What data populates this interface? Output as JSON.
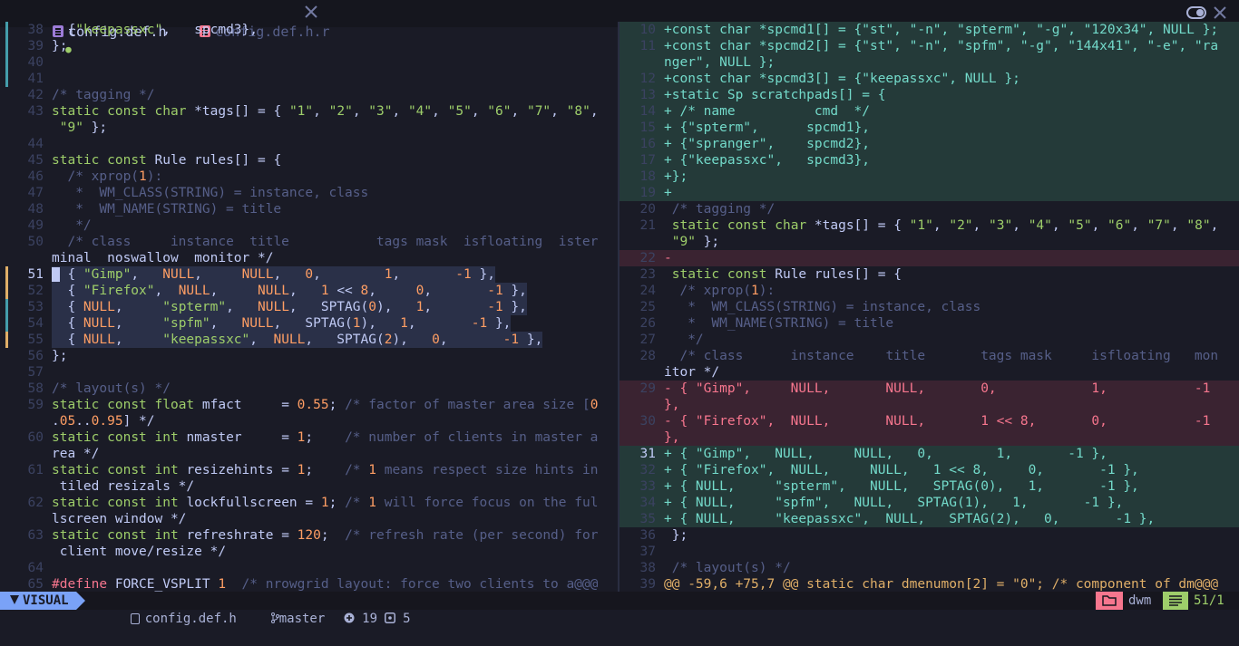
{
  "tabs": [
    {
      "label": "config.def.h",
      "active": true,
      "modified": true,
      "modified_glyph": "●"
    },
    {
      "label": "config.def.h.r",
      "active": false
    }
  ],
  "left": {
    "rows": [
      {
        "n": "38",
        "g": "grn",
        "t": "  {\"keepassxc\",   spcmd3},"
      },
      {
        "n": "39",
        "g": "grn",
        "t": "};"
      },
      {
        "n": "40",
        "g": "grn",
        "t": ""
      },
      {
        "n": "41",
        "g": "grn",
        "t": ""
      },
      {
        "n": "42",
        "t": "/* tagging */"
      },
      {
        "n": "43",
        "t": "static const char *tags[] = { \"1\", \"2\", \"3\", \"4\", \"5\", \"6\", \"7\", \"8\","
      },
      {
        "n": "",
        "t": " \"9\" };"
      },
      {
        "n": "44",
        "t": ""
      },
      {
        "n": "45",
        "t": "static const Rule rules[] = {"
      },
      {
        "n": "46",
        "t": "  /* xprop(1):"
      },
      {
        "n": "47",
        "t": "   *  WM_CLASS(STRING) = instance, class"
      },
      {
        "n": "48",
        "t": "   *  WM_NAME(STRING) = title"
      },
      {
        "n": "49",
        "t": "   */"
      },
      {
        "n": "50",
        "t": "  /* class     instance  title           tags mask  isfloating  ister"
      },
      {
        "n": "",
        "t": "minal  noswallow  monitor */"
      },
      {
        "n": "51",
        "g": "chg",
        "cur": true,
        "sel": true,
        "t": "  { \"Gimp\",   NULL,     NULL,   0,        1,       -1 },"
      },
      {
        "n": "52",
        "g": "chg",
        "sel": true,
        "t": "  { \"Firefox\",  NULL,     NULL,   1 << 8,     0,       -1 },"
      },
      {
        "n": "53",
        "g": "grn",
        "sel": true,
        "t": "  { NULL,     \"spterm\",   NULL,   SPTAG(0),   1,       -1 },"
      },
      {
        "n": "54",
        "g": "grn",
        "sel": true,
        "t": "  { NULL,     \"spfm\",   NULL,   SPTAG(1),   1,       -1 },"
      },
      {
        "n": "55",
        "g": "chg",
        "sel": true,
        "t": "  { NULL,     \"keepassxc\",  NULL,   SPTAG(2),   0,       -1 },"
      },
      {
        "n": "56",
        "t": "};"
      },
      {
        "n": "57",
        "t": ""
      },
      {
        "n": "58",
        "t": "/* layout(s) */"
      },
      {
        "n": "59",
        "t": "static const float mfact     = 0.55; /* factor of master area size [0"
      },
      {
        "n": "",
        "t": ".05..0.95] */"
      },
      {
        "n": "60",
        "t": "static const int nmaster     = 1;    /* number of clients in master a"
      },
      {
        "n": "",
        "t": "rea */"
      },
      {
        "n": "61",
        "t": "static const int resizehints = 1;    /* 1 means respect size hints in"
      },
      {
        "n": "",
        "t": " tiled resizals */"
      },
      {
        "n": "62",
        "t": "static const int lockfullscreen = 1; /* 1 will force focus on the ful"
      },
      {
        "n": "",
        "t": "lscreen window */"
      },
      {
        "n": "63",
        "t": "static const int refreshrate = 120;  /* refresh rate (per second) for"
      },
      {
        "n": "",
        "t": " client move/resize */"
      },
      {
        "n": "64",
        "t": ""
      },
      {
        "n": "65",
        "t": "#define FORCE_VSPLIT 1  /* nrowgrid layout: force two clients to a@@@"
      }
    ]
  },
  "right": {
    "rows": [
      {
        "n": "10",
        "d": "add",
        "t": "+const char *spcmd1[] = {\"st\", \"-n\", \"spterm\", \"-g\", \"120x34\", NULL };"
      },
      {
        "n": "11",
        "d": "add",
        "t": "+const char *spcmd2[] = {\"st\", \"-n\", \"spfm\", \"-g\", \"144x41\", \"-e\", \"ra"
      },
      {
        "n": "",
        "d": "add",
        "t": "nger\", NULL };"
      },
      {
        "n": "12",
        "d": "add",
        "t": "+const char *spcmd3[] = {\"keepassxc\", NULL };"
      },
      {
        "n": "13",
        "d": "add",
        "t": "+static Sp scratchpads[] = {"
      },
      {
        "n": "14",
        "d": "add",
        "t": "+ /* name          cmd  */"
      },
      {
        "n": "15",
        "d": "add",
        "t": "+ {\"spterm\",      spcmd1},"
      },
      {
        "n": "16",
        "d": "add",
        "t": "+ {\"spranger\",    spcmd2},"
      },
      {
        "n": "17",
        "d": "add",
        "t": "+ {\"keepassxc\",   spcmd3},"
      },
      {
        "n": "18",
        "d": "add",
        "t": "+};"
      },
      {
        "n": "19",
        "d": "add",
        "t": "+"
      },
      {
        "n": "20",
        "t": " /* tagging */"
      },
      {
        "n": "21",
        "t": " static const char *tags[] = { \"1\", \"2\", \"3\", \"4\", \"5\", \"6\", \"7\", \"8\","
      },
      {
        "n": "",
        "t": " \"9\" };"
      },
      {
        "n": "22",
        "d": "del",
        "t": "-"
      },
      {
        "n": "23",
        "t": " static const Rule rules[] = {"
      },
      {
        "n": "24",
        "t": "  /* xprop(1):"
      },
      {
        "n": "25",
        "t": "   *  WM_CLASS(STRING) = instance, class"
      },
      {
        "n": "26",
        "t": "   *  WM_NAME(STRING) = title"
      },
      {
        "n": "27",
        "t": "   */"
      },
      {
        "n": "28",
        "t": "  /* class      instance    title       tags mask     isfloating   mon"
      },
      {
        "n": "",
        "t": "itor */"
      },
      {
        "n": "29",
        "d": "del",
        "t": "- { \"Gimp\",     NULL,       NULL,       0,            1,           -1"
      },
      {
        "n": "",
        "d": "del",
        "t": "},"
      },
      {
        "n": "30",
        "d": "del",
        "t": "- { \"Firefox\",  NULL,       NULL,       1 << 8,       0,           -1"
      },
      {
        "n": "",
        "d": "del",
        "t": "},"
      },
      {
        "n": "31",
        "cur": true,
        "d": "add",
        "t": "+ { \"Gimp\",   NULL,     NULL,   0,        1,       -1 },"
      },
      {
        "n": "32",
        "d": "add",
        "t": "+ { \"Firefox\",  NULL,     NULL,   1 << 8,     0,       -1 },"
      },
      {
        "n": "33",
        "d": "add",
        "t": "+ { NULL,     \"spterm\",   NULL,   SPTAG(0),   1,       -1 },"
      },
      {
        "n": "34",
        "d": "add",
        "t": "+ { NULL,     \"spfm\",   NULL,   SPTAG(1),   1,       -1 },"
      },
      {
        "n": "35",
        "d": "add",
        "t": "+ { NULL,     \"keepassxc\",  NULL,   SPTAG(2),   0,       -1 },"
      },
      {
        "n": "36",
        "t": " };"
      },
      {
        "n": "37",
        "t": ""
      },
      {
        "n": "38",
        "t": " /* layout(s) */"
      },
      {
        "n": "39",
        "hunk": true,
        "t": "@@ -59,6 +75,7 @@ static char dmenumon[2] = \"0\"; /* component of dm@@@"
      }
    ]
  },
  "statusline": {
    "mode": "VISUAL",
    "file": "config.def.h",
    "branch": "master",
    "added": "19",
    "changed": "5",
    "wm": "dwm",
    "position": "51/1"
  },
  "colors": {
    "accent": "#7aa2f7",
    "add_bg": "#243a39",
    "del_bg": "#3a2331",
    "selection": "#2a3048"
  }
}
